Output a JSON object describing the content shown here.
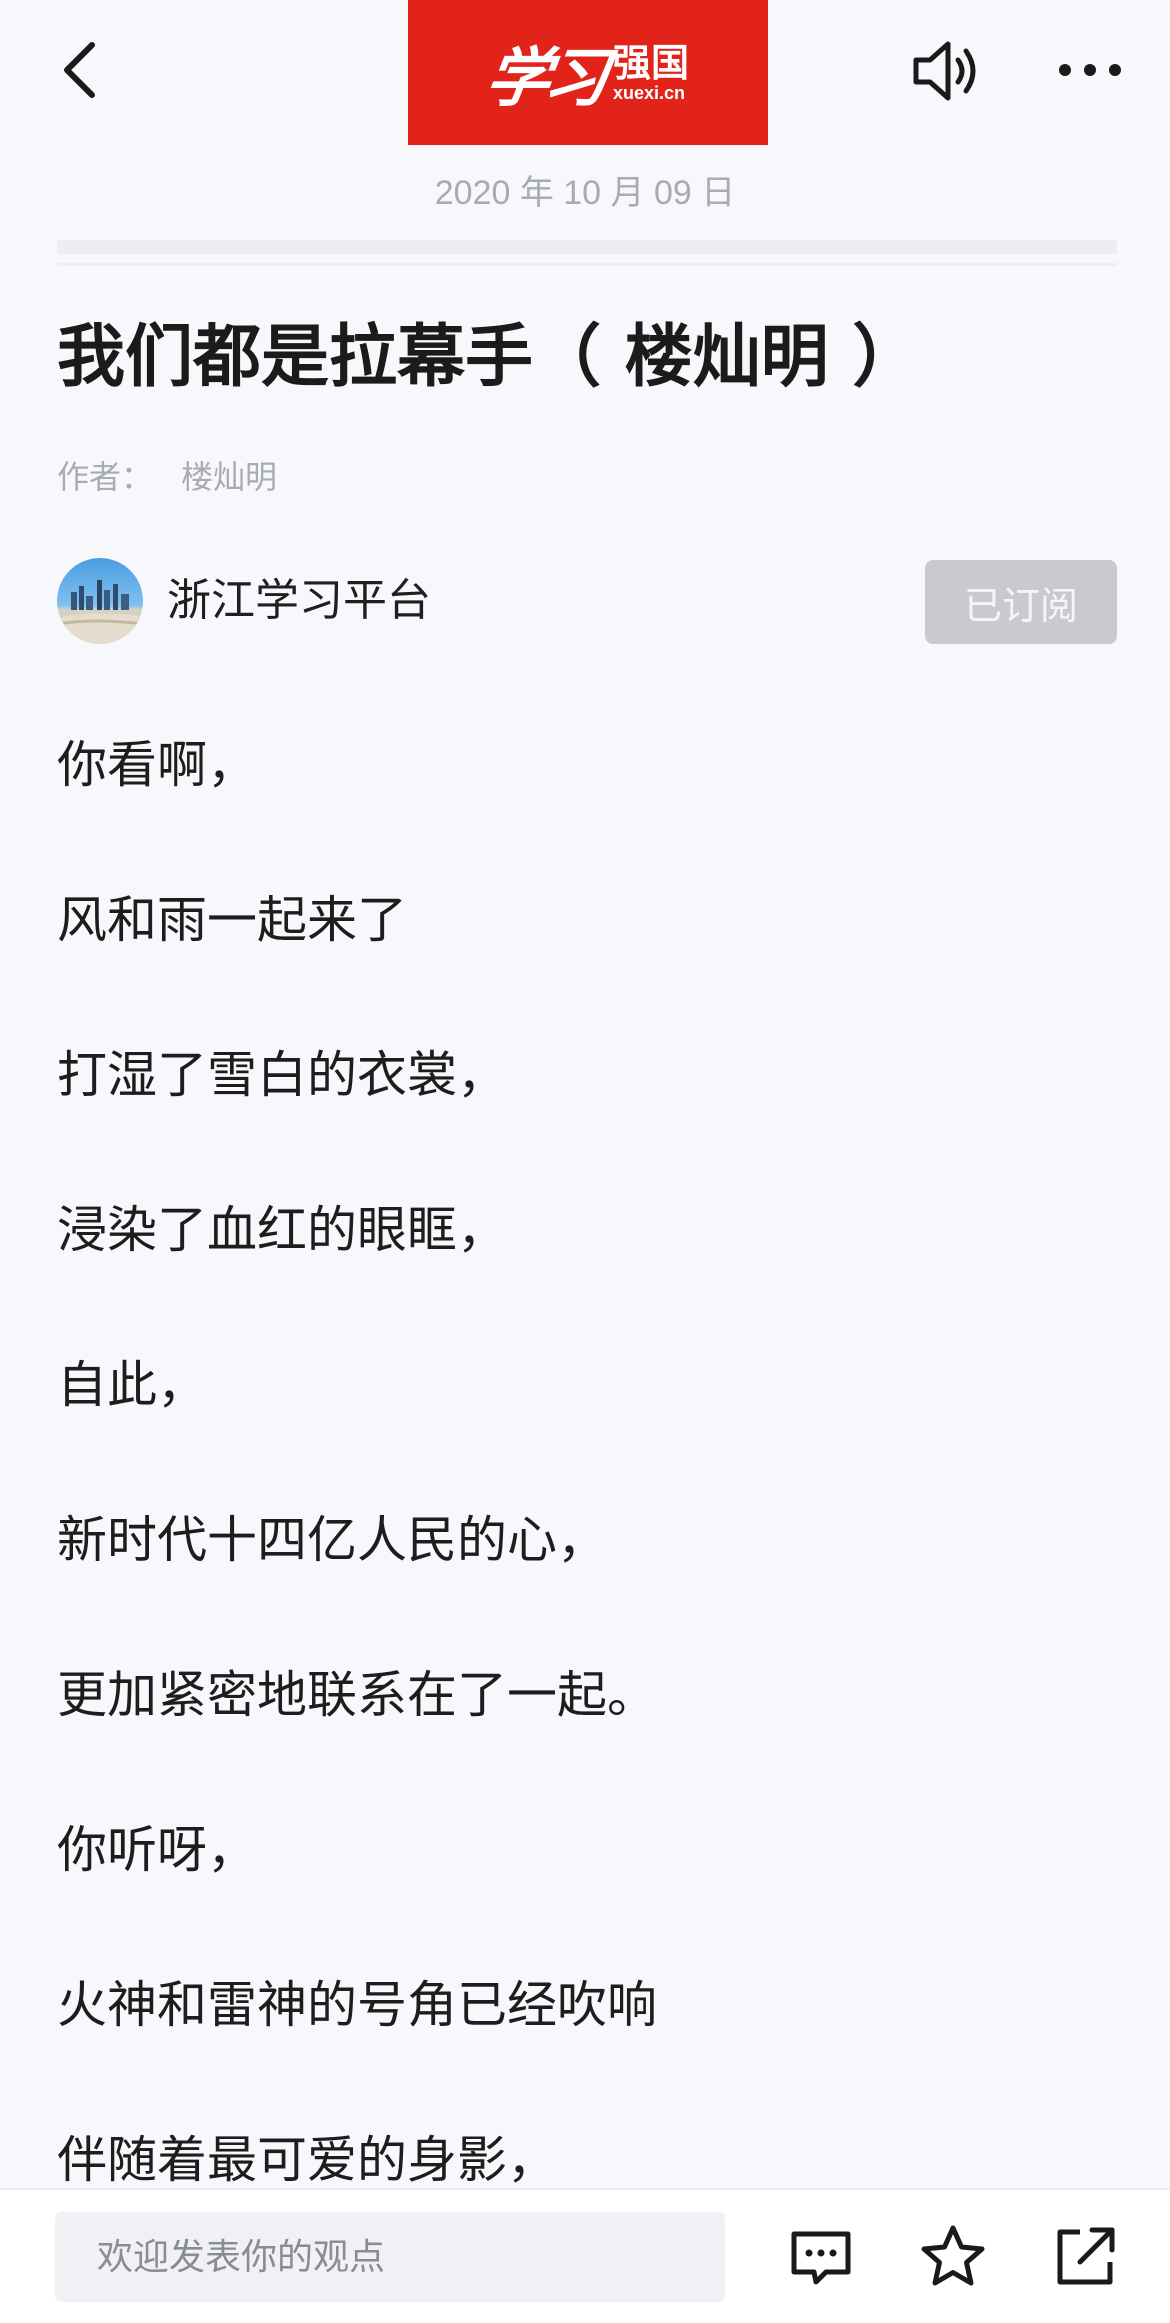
{
  "header": {
    "back_icon": "chevron-left-icon",
    "logo": {
      "script_text": "学习",
      "name_text": "强国",
      "domain_text": "xuexi.cn",
      "background_color": "#e2231a"
    },
    "speaker_icon": "speaker-icon",
    "more_icon": "more-horizontal-icon"
  },
  "article": {
    "date": "2020 年 10 月 09 日",
    "title": "我们都是拉幕手（ 楼灿明 ）",
    "author_label": "作者：",
    "author_name": "楼灿明",
    "source": {
      "name": "浙江学习平台",
      "subscribe_label": "已订阅"
    },
    "lines": [
      "你看啊，",
      "风和雨一起来了",
      "打湿了雪白的衣裳，",
      "浸染了血红的眼眶，",
      "自此，",
      "新时代十四亿人民的心，",
      "更加紧密地联系在了一起。",
      "你听呀，",
      "火神和雷神的号角已经吹响",
      "伴随着最可爱的身影，"
    ]
  },
  "bottom_bar": {
    "comment_placeholder": "欢迎发表你的观点",
    "comments_icon": "comment-bubble-icon",
    "favorite_icon": "star-icon",
    "share_icon": "share-icon"
  }
}
